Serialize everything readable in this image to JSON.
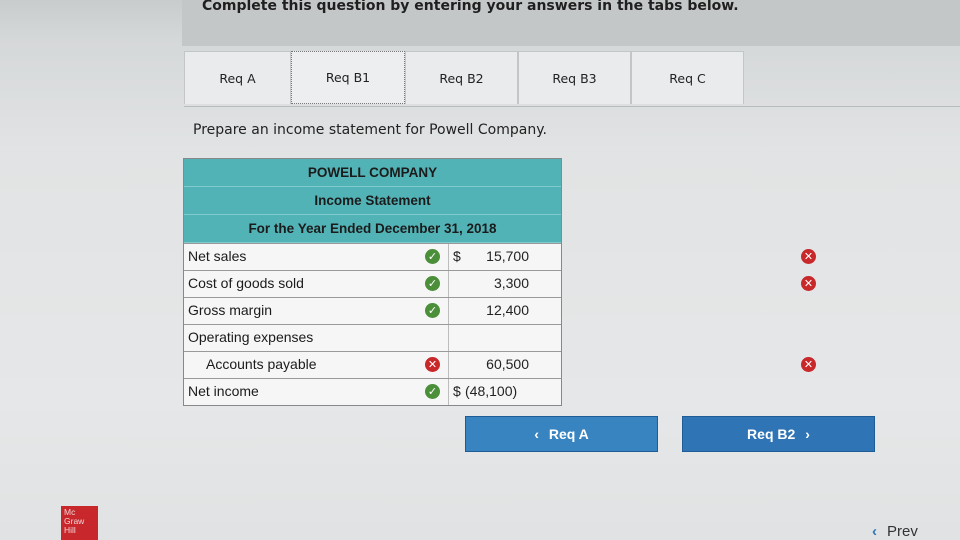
{
  "header": {
    "instruction": "Complete this question by entering your answers in the tabs below."
  },
  "tabs": [
    {
      "label": "Req A",
      "active": false
    },
    {
      "label": "Req B1",
      "active": true
    },
    {
      "label": "Req B2",
      "active": false
    },
    {
      "label": "Req B3",
      "active": false
    },
    {
      "label": "Req C",
      "active": false
    }
  ],
  "prompt": "Prepare an income statement for Powell Company.",
  "statement": {
    "company": "POWELL COMPANY",
    "title": "Income Statement",
    "period": "For the Year Ended December 31, 2018",
    "rows": [
      {
        "label": "Net sales",
        "label_status": "correct",
        "dollar": "$",
        "amount": "15,700",
        "amount_status": "incorrect"
      },
      {
        "label": "Cost of goods sold",
        "label_status": "correct",
        "dollar": "",
        "amount": "3,300",
        "amount_status": "incorrect"
      },
      {
        "label": "Gross margin",
        "label_status": "correct",
        "dollar": "",
        "amount": "12,400",
        "amount_status": ""
      },
      {
        "label": "Operating expenses",
        "label_status": "",
        "dollar": "",
        "amount": "",
        "amount_status": ""
      },
      {
        "label": "Accounts payable",
        "label_status": "incorrect",
        "dollar": "",
        "amount": "60,500",
        "amount_status": "incorrect"
      },
      {
        "label": "Net income",
        "label_status": "correct",
        "dollar": "$",
        "amount": "(48,100)",
        "amount_status": ""
      }
    ]
  },
  "nav": {
    "prev_label": "Req A",
    "next_label": "Req B2",
    "prev_arrow": "‹",
    "next_arrow": "›"
  },
  "footer": {
    "logo_line1": "Mc",
    "logo_line2": "Graw",
    "logo_line3": "Hill",
    "prev_text": "Prev",
    "prev_arrow": "‹"
  },
  "colors": {
    "table_header": "#52b3b7",
    "button": "#2f74b4",
    "correct": "#4b8f3b",
    "incorrect": "#c8282a",
    "logo": "#c8272c"
  }
}
